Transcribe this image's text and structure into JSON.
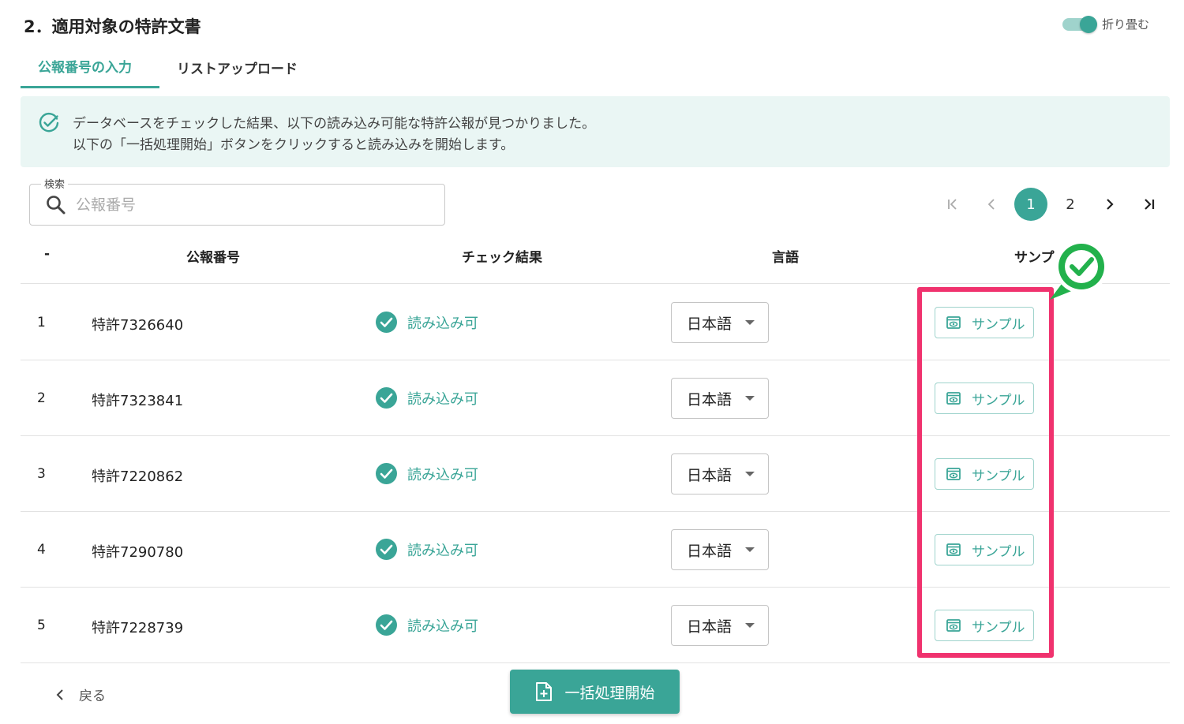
{
  "section": {
    "title": "2．適用対象の特許文書",
    "collapse_label": "折り畳む"
  },
  "tabs": [
    {
      "label": "公報番号の入力",
      "active": true
    },
    {
      "label": "リストアップロード",
      "active": false
    }
  ],
  "alert": {
    "line1": "データベースをチェックした結果、以下の読み込み可能な特許公報が見つかりました。",
    "line2": "以下の「一括処理開始」ボタンをクリックすると読み込みを開始します。"
  },
  "search": {
    "legend": "検索",
    "placeholder": "公報番号",
    "value": ""
  },
  "pagination": {
    "pages": [
      "1",
      "2"
    ],
    "current": "1"
  },
  "table": {
    "headers": [
      "-",
      "公報番号",
      "チェック結果",
      "言語",
      "サンプ"
    ],
    "rows": [
      {
        "num": "1",
        "pub": "特許7326640",
        "status": "読み込み可",
        "lang": "日本語",
        "sample": "サンプル"
      },
      {
        "num": "2",
        "pub": "特許7323841",
        "status": "読み込み可",
        "lang": "日本語",
        "sample": "サンプル"
      },
      {
        "num": "3",
        "pub": "特許7220862",
        "status": "読み込み可",
        "lang": "日本語",
        "sample": "サンプル"
      },
      {
        "num": "4",
        "pub": "特許7290780",
        "status": "読み込み可",
        "lang": "日本語",
        "sample": "サンプル"
      },
      {
        "num": "5",
        "pub": "特許7228739",
        "status": "読み込み可",
        "lang": "日本語",
        "sample": "サンプル"
      }
    ]
  },
  "footer": {
    "back_label": "戻る",
    "bulk_label": "一括処理開始"
  },
  "colors": {
    "accent": "#3aa597",
    "highlight": "#f0326e",
    "badge": "#22b14c"
  }
}
